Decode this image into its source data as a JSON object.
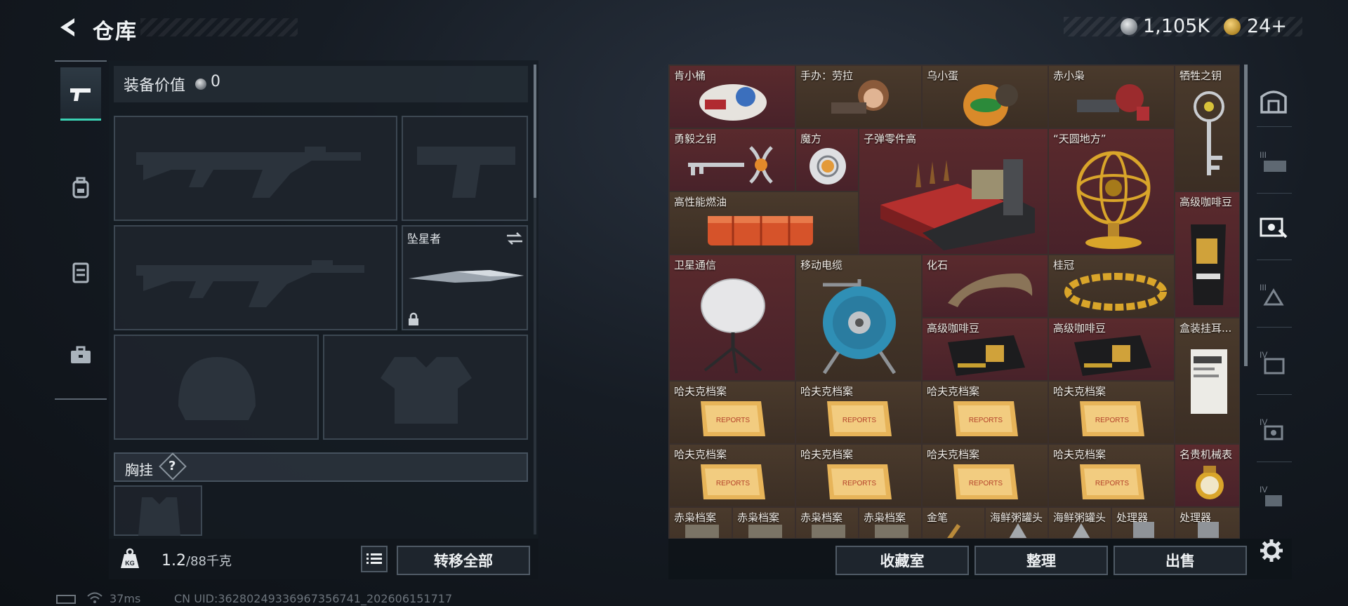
{
  "header": {
    "title": "仓库"
  },
  "currency": {
    "silver_value": "1,105K",
    "gold_value": "24+"
  },
  "equipment": {
    "value_label": "装备价值",
    "value": "0",
    "melee_slot_label": "坠星者",
    "chest_label": "胸挂",
    "chest_help": "?",
    "weight_current": "1.2",
    "weight_max": "/88千克",
    "transfer_all_label": "转移全部"
  },
  "storage": {
    "items": [
      {
        "label": "肯小桶",
        "color": "red"
      },
      {
        "label": "手办：劳拉",
        "color": "brown"
      },
      {
        "label": "乌小蛋",
        "color": "brown"
      },
      {
        "label": "赤小枭",
        "color": "brown"
      },
      {
        "label": "牺牲之钥",
        "color": "brown"
      },
      {
        "label": "勇毅之钥",
        "color": "red"
      },
      {
        "label": "魔方",
        "color": "red"
      },
      {
        "label": "子弹零件高",
        "color": "red"
      },
      {
        "label": "“天圆地方”",
        "color": "red"
      },
      {
        "label": "高性能燃油",
        "color": "brown"
      },
      {
        "label": "高级咖啡豆",
        "color": "red"
      },
      {
        "label": "卫星通信",
        "color": "red"
      },
      {
        "label": "移动电缆",
        "color": "brown"
      },
      {
        "label": "化石",
        "color": "red"
      },
      {
        "label": "桂冠",
        "color": "brown"
      },
      {
        "label": "高级咖啡豆",
        "color": "red"
      },
      {
        "label": "高级咖啡豆",
        "color": "red"
      },
      {
        "label": "盒装挂耳...",
        "color": "brown"
      },
      {
        "label": "哈夫克档案",
        "color": "brown"
      },
      {
        "label": "哈夫克档案",
        "color": "brown"
      },
      {
        "label": "哈夫克档案",
        "color": "brown"
      },
      {
        "label": "哈夫克档案",
        "color": "brown"
      },
      {
        "label": "哈夫克档案",
        "color": "brown"
      },
      {
        "label": "哈夫克档案",
        "color": "brown"
      },
      {
        "label": "哈夫克档案",
        "color": "brown"
      },
      {
        "label": "哈夫克档案",
        "color": "brown"
      },
      {
        "label": "名贵机械表",
        "color": "red"
      },
      {
        "label": "赤枭档案",
        "color": "brown"
      },
      {
        "label": "赤枭档案",
        "color": "brown"
      },
      {
        "label": "赤枭档案",
        "color": "brown"
      },
      {
        "label": "赤枭档案",
        "color": "brown"
      },
      {
        "label": "金笔",
        "color": "brown"
      },
      {
        "label": "海鲜粥罐头",
        "color": "brown"
      },
      {
        "label": "海鲜粥罐头",
        "color": "brown"
      },
      {
        "label": "处理器",
        "color": "brown"
      },
      {
        "label": "处理器",
        "color": "brown"
      }
    ],
    "collection_label": "收藏室",
    "sort_label": "整理",
    "sell_label": "出售"
  },
  "status_bar": {
    "ping": "37ms",
    "uid": "CN UID:36280249336967356741_202606151717"
  },
  "colors": {
    "accent": "#3ad1b3",
    "red_cell": "#5a2a2d",
    "brown_cell": "#4a3a2c"
  }
}
